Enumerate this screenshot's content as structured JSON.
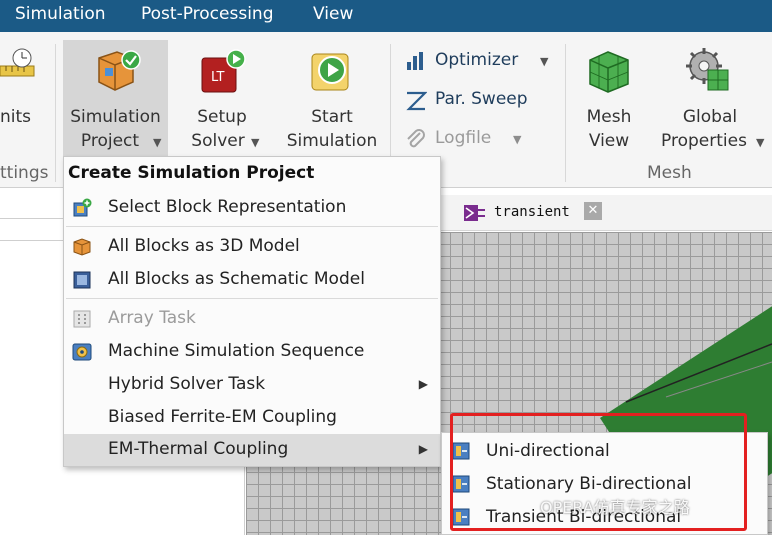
{
  "menubar": {
    "items": [
      "Simulation",
      "Post-Processing",
      "View"
    ]
  },
  "ribbon": {
    "units_label": "nits",
    "settings_group": "ttings",
    "simulation_project": [
      "Simulation",
      "Project"
    ],
    "setup_solver": [
      "Setup",
      "Solver"
    ],
    "start_simulation": [
      "Start",
      "Simulation"
    ],
    "optimizer": "Optimizer",
    "par_sweep": "Par. Sweep",
    "logfile": "Logfile",
    "mesh_view": [
      "Mesh",
      "View"
    ],
    "global_properties": [
      "Global",
      "Properties"
    ],
    "mesh_group": "Mesh",
    "lt_icon_text": "LT"
  },
  "dropdown": {
    "heading": "Create Simulation Project",
    "items": [
      {
        "label": "Select Block Representation"
      },
      {
        "label": "All Blocks as 3D Model"
      },
      {
        "label": "All Blocks as Schematic Model"
      },
      {
        "label": "Array Task"
      },
      {
        "label": "Machine Simulation Sequence"
      },
      {
        "label": "Hybrid Solver Task"
      },
      {
        "label": "Biased Ferrite-EM Coupling"
      },
      {
        "label": "EM-Thermal Coupling"
      }
    ]
  },
  "submenu": {
    "items": [
      {
        "label": "Uni-directional"
      },
      {
        "label": "Stationary Bi-directional"
      },
      {
        "label": "Transient Bi-directional"
      }
    ]
  },
  "tab": {
    "label": "transient"
  },
  "watermark": "OPERA仿真专家之路",
  "colors": {
    "menubar": "#1b5a86",
    "highlight_box": "#e32020",
    "mesh_green": "#2e7d32"
  }
}
